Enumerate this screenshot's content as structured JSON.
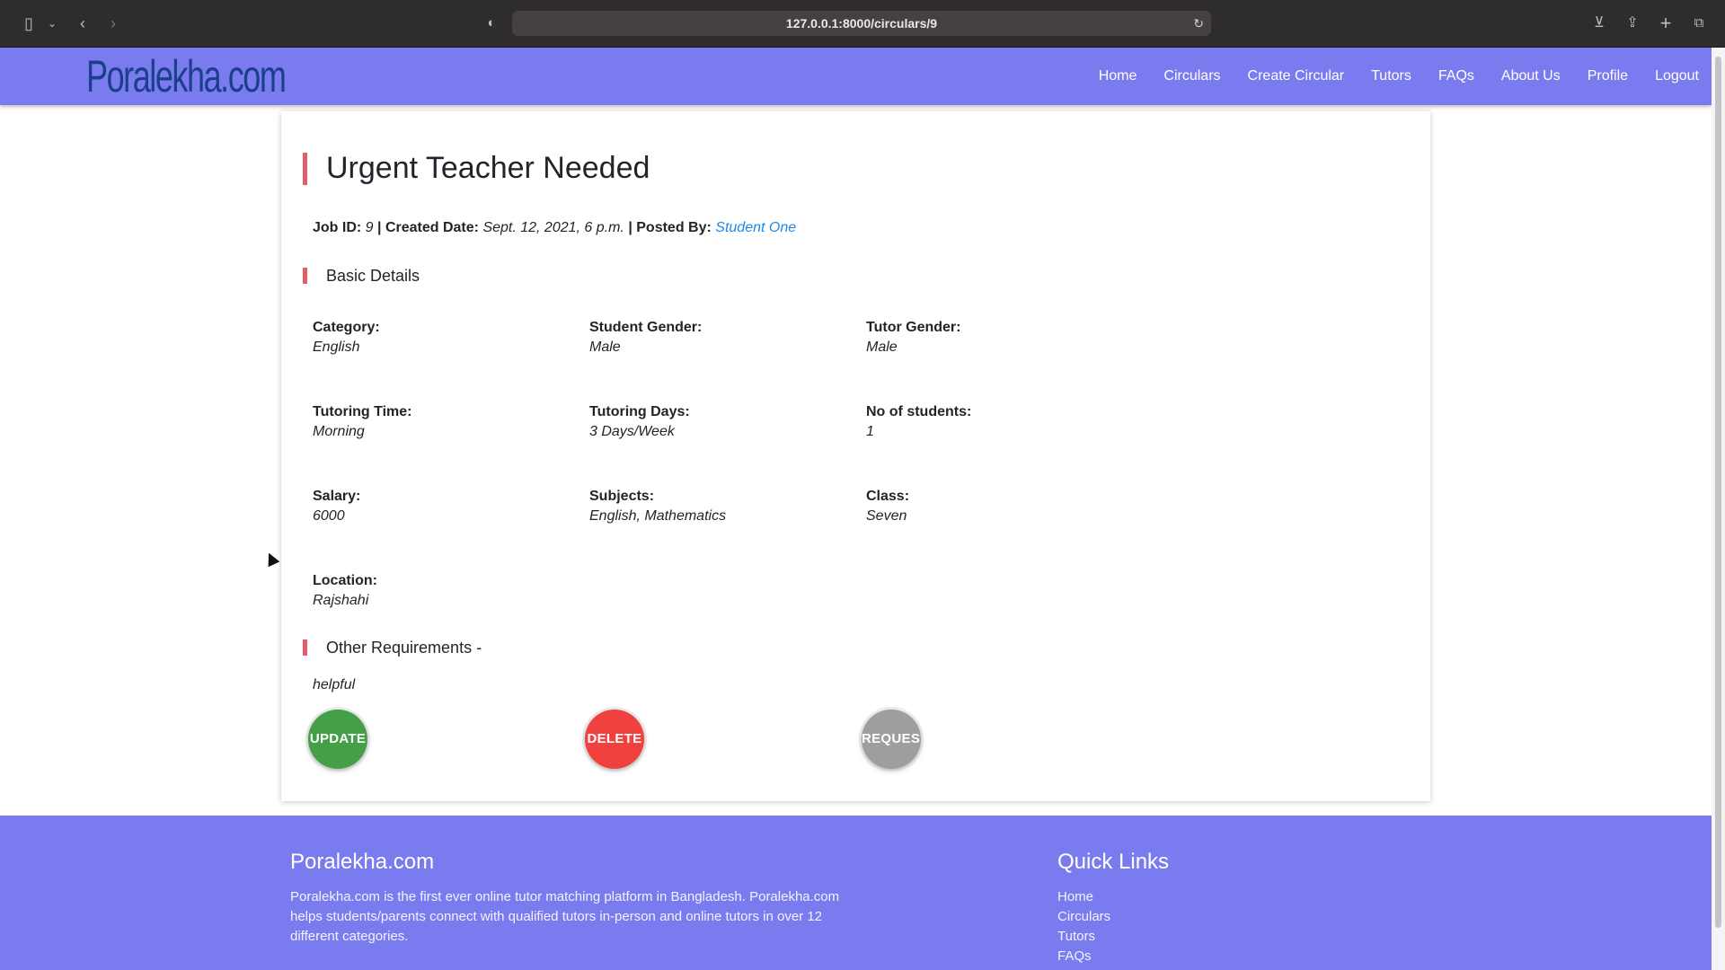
{
  "browser": {
    "url": "127.0.0.1:8000/circulars/9"
  },
  "navbar": {
    "logo": "Poralekha.com",
    "links": [
      "Home",
      "Circulars",
      "Create Circular",
      "Tutors",
      "FAQs",
      "About Us",
      "Profile",
      "Logout"
    ]
  },
  "circular": {
    "title": "Urgent Teacher Needed",
    "meta": {
      "job_id_label": "Job ID:",
      "job_id": "9",
      "created_label": "| Created Date:",
      "created_date": "Sept. 12, 2021, 6 p.m.",
      "posted_label": "| Posted By:",
      "posted_by": "Student One"
    },
    "basic_details_heading": "Basic Details",
    "fields": [
      {
        "label": "Category:",
        "value": "English"
      },
      {
        "label": "Student Gender:",
        "value": "Male"
      },
      {
        "label": "Tutor Gender:",
        "value": "Male"
      },
      {
        "label": "Tutoring Time:",
        "value": "Morning"
      },
      {
        "label": "Tutoring Days:",
        "value": "3 Days/Week"
      },
      {
        "label": "No of students:",
        "value": "1"
      },
      {
        "label": "Salary:",
        "value": "6000"
      },
      {
        "label": "Subjects:",
        "value": "English, Mathematics"
      },
      {
        "label": "Class:",
        "value": "Seven"
      },
      {
        "label": "Location:",
        "value": "Rajshahi"
      }
    ],
    "other_requirements_heading": "Other Requirements -",
    "other_requirements": "helpful",
    "buttons": {
      "update": "UPDATE",
      "delete": "DELETE",
      "request": "REQUEST"
    }
  },
  "footer": {
    "brand": "Poralekha.com",
    "description": "Poralekha.com is the first ever online tutor matching platform in Bangladesh. Poralekha.com helps students/parents connect with qualified tutors in-person and online tutors in over 12 different categories.",
    "quick_links_heading": "Quick Links",
    "quick_links": [
      "Home",
      "Circulars",
      "Tutors",
      "FAQs"
    ]
  },
  "colors": {
    "navbar_bg": "#7b7bf0",
    "accent_bar": "#e35d6a",
    "update_btn": "#43a047",
    "delete_btn": "#f0413f",
    "request_btn": "#9e9e9e",
    "link": "#1e88e5"
  }
}
